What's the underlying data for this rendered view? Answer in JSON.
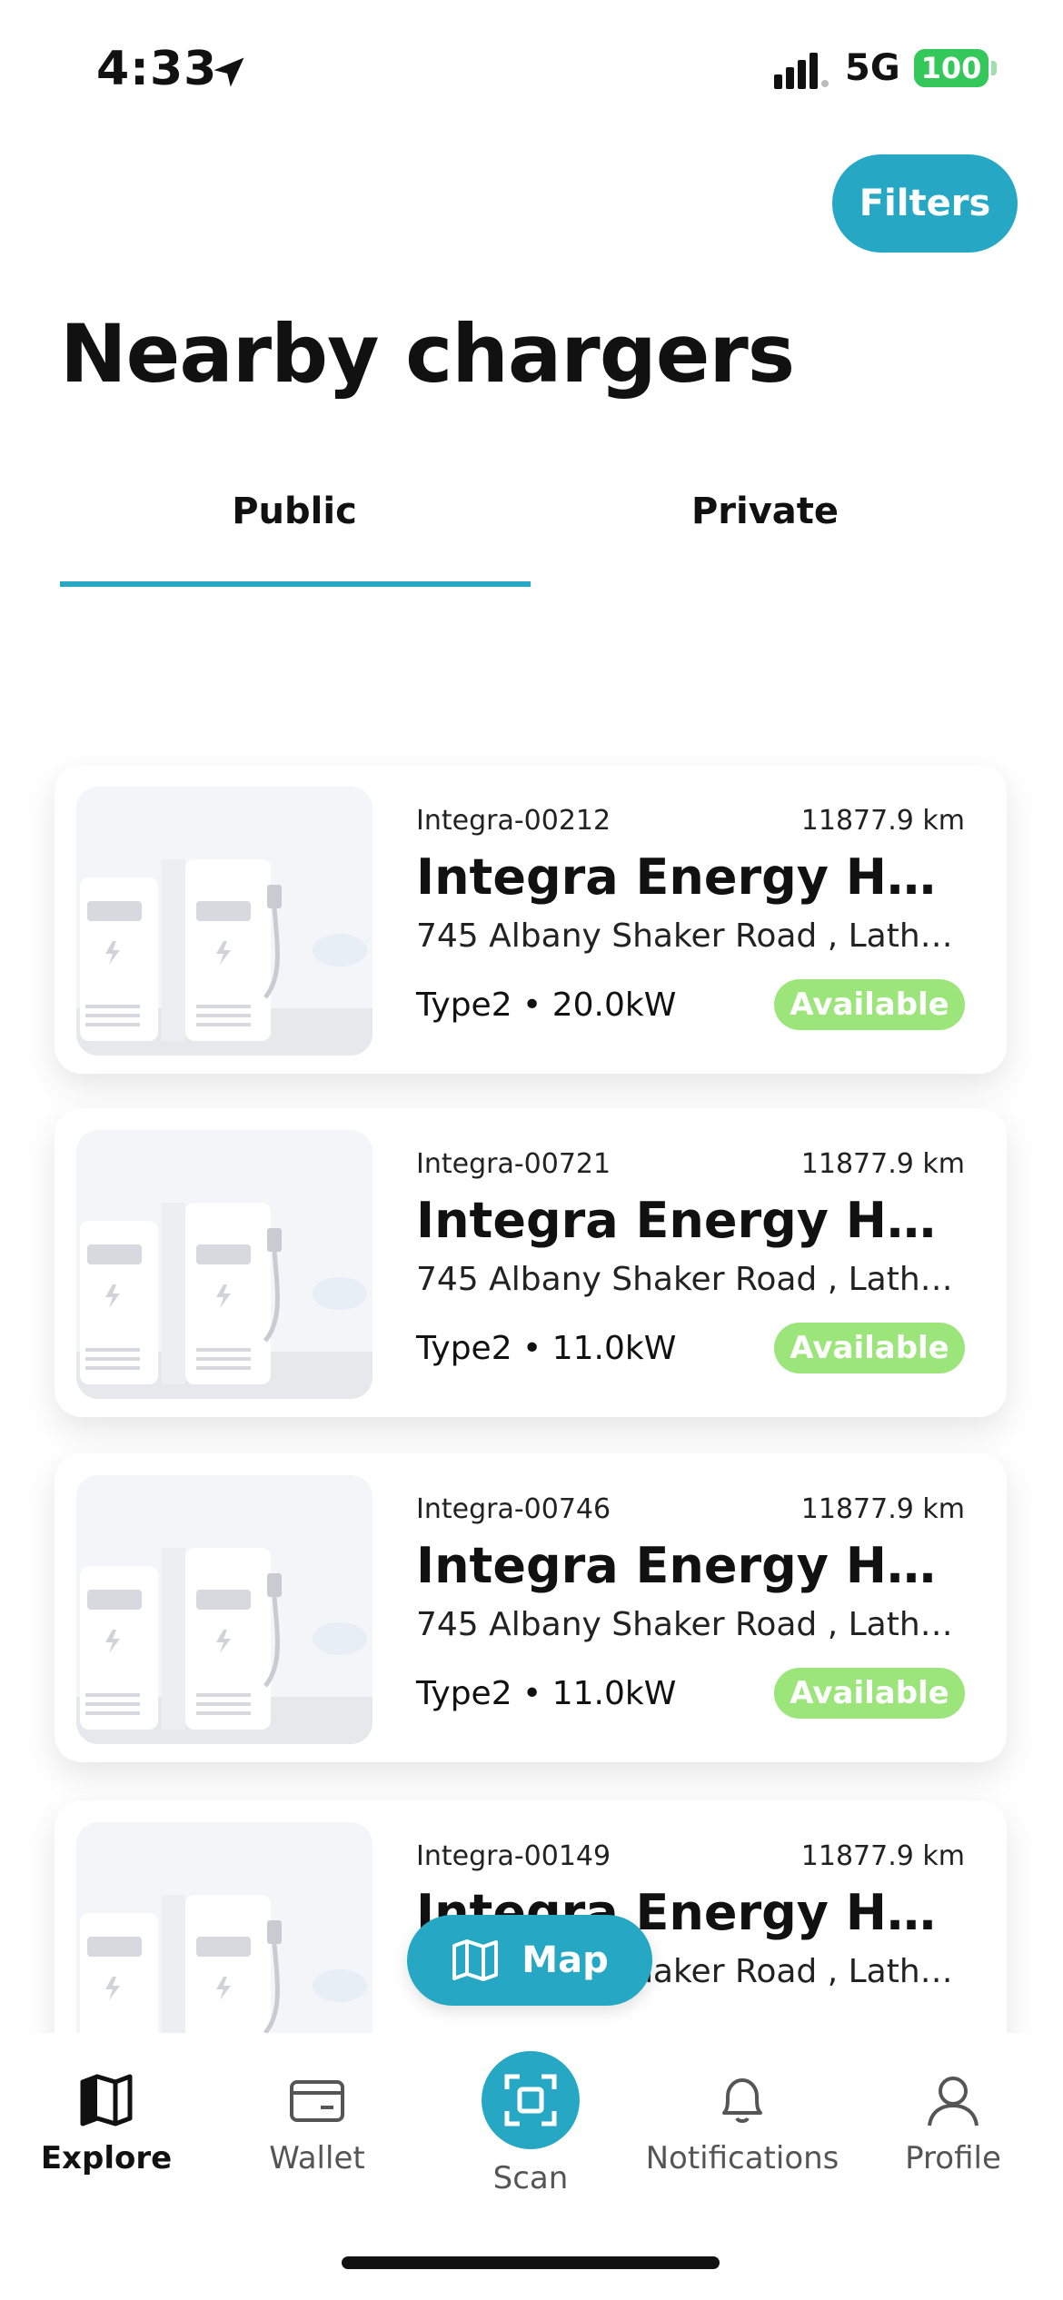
{
  "status_bar": {
    "time": "4:33",
    "network": "5G",
    "battery": "100"
  },
  "header": {
    "filters_label": "Filters",
    "title": "Nearby chargers"
  },
  "tabs": [
    {
      "label": "Public",
      "active": true
    },
    {
      "label": "Private",
      "active": false
    }
  ],
  "chargers": [
    {
      "id": "Integra-00212",
      "distance": "11877.9 km",
      "name": "Integra Energy Head...",
      "address": "745 Albany Shaker Road , Latham...",
      "spec": "Type2 • 20.0kW",
      "status": "Available"
    },
    {
      "id": "Integra-00721",
      "distance": "11877.9 km",
      "name": "Integra Energy Head...",
      "address": "745 Albany Shaker Road , Latham...",
      "spec": "Type2 • 11.0kW",
      "status": "Available"
    },
    {
      "id": "Integra-00746",
      "distance": "11877.9 km",
      "name": "Integra Energy Head...",
      "address": "745 Albany Shaker Road , Latham...",
      "spec": "Type2 • 11.0kW",
      "status": "Available"
    },
    {
      "id": "Integra-00149",
      "distance": "11877.9 km",
      "name": "Integra Energy Head...",
      "address": "745 Albany Shaker Road , Latham...",
      "spec": "",
      "status": ""
    }
  ],
  "map_button": {
    "label": "Map"
  },
  "bottom_nav": {
    "explore": "Explore",
    "wallet": "Wallet",
    "scan": "Scan",
    "notifications": "Notifications",
    "profile": "Profile"
  },
  "colors": {
    "accent": "#26a8c4",
    "available": "#9be57a",
    "battery": "#34c759"
  },
  "icons": [
    "location-arrow-icon",
    "signal-icon",
    "map-icon",
    "explore-map-icon",
    "wallet-icon",
    "scan-icon",
    "bell-icon",
    "profile-icon"
  ]
}
